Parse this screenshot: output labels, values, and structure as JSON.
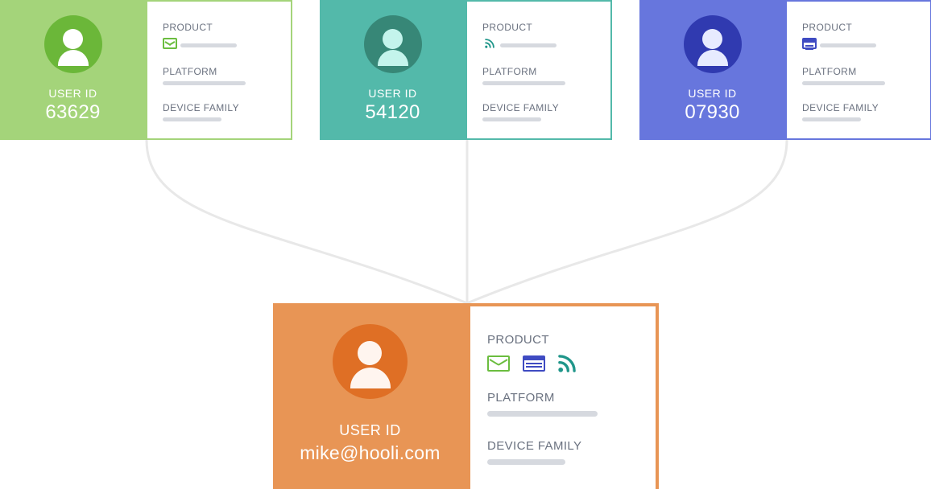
{
  "cards": [
    {
      "id": "green",
      "user_id_label": "USER ID",
      "user_id_value": "63629",
      "meta": {
        "product": "PRODUCT",
        "platform": "PLATFORM",
        "device_family": "DEVICE FAMILY"
      },
      "product_icon": "mail-icon",
      "colors": {
        "accent": "#a4d47a",
        "avatar": "#6bb739"
      }
    },
    {
      "id": "teal",
      "user_id_label": "USER ID",
      "user_id_value": "54120",
      "meta": {
        "product": "PRODUCT",
        "platform": "PLATFORM",
        "device_family": "DEVICE FAMILY"
      },
      "product_icon": "rss-icon",
      "colors": {
        "accent": "#53b9aa",
        "avatar": "#378777"
      }
    },
    {
      "id": "blue",
      "user_id_label": "USER ID",
      "user_id_value": "07930",
      "meta": {
        "product": "PRODUCT",
        "platform": "PLATFORM",
        "device_family": "DEVICE FAMILY"
      },
      "product_icon": "browser-icon",
      "colors": {
        "accent": "#6776dd",
        "avatar": "#303ab0"
      }
    }
  ],
  "merged": {
    "user_id_label": "USER ID",
    "user_id_value": "mike@hooli.com",
    "meta": {
      "product": "PRODUCT",
      "platform": "PLATFORM",
      "device_family": "DEVICE FAMILY"
    },
    "product_icons": [
      "mail-icon",
      "browser-icon",
      "rss-icon"
    ],
    "colors": {
      "accent": "#e89555",
      "avatar": "#df6f25"
    }
  },
  "palette": {
    "connector": "#e8e8e8",
    "placeholder_bar": "#d6d9df",
    "label_text": "#6b7280"
  }
}
